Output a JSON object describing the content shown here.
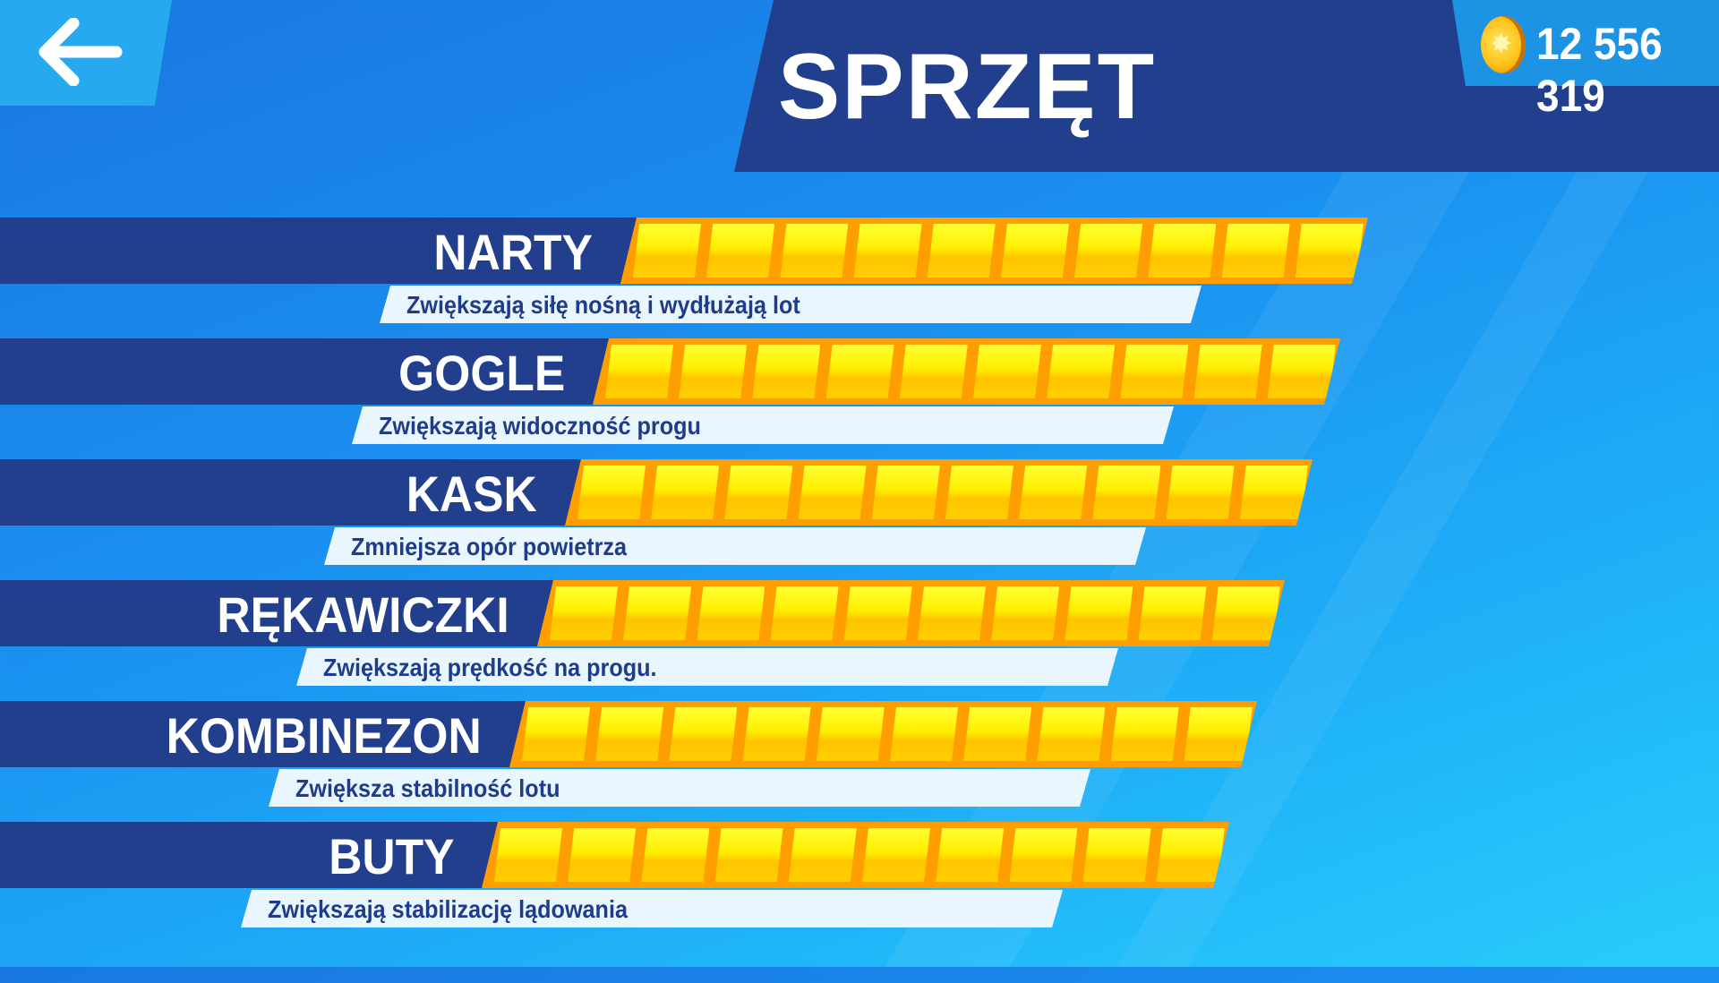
{
  "header": {
    "title": "SPRZĘT",
    "back_icon": "arrow-left-icon"
  },
  "wallet": {
    "coin_icon": "coin-icon",
    "amount": "12 556 319"
  },
  "equipment": [
    {
      "name": "NARTY",
      "description": "Zwiększają siłę nośną i wydłużają lot",
      "level": 10,
      "max_level": 10
    },
    {
      "name": "GOGLE",
      "description": "Zwiększają widoczność progu",
      "level": 10,
      "max_level": 10
    },
    {
      "name": "KASK",
      "description": "Zmniejsza opór powietrza",
      "level": 10,
      "max_level": 10
    },
    {
      "name": "RĘKAWICZKI",
      "description": "Zwiększają prędkość na progu.",
      "level": 10,
      "max_level": 10
    },
    {
      "name": "KOMBINEZON",
      "description": "Zwiększa stabilność lotu",
      "level": 10,
      "max_level": 10
    },
    {
      "name": "BUTY",
      "description": "Zwiększają stabilizację lądowania",
      "level": 10,
      "max_level": 10
    }
  ],
  "colors": {
    "background": "#1a8ff0",
    "banner": "#213f8c",
    "bar_fill": "#ffee00",
    "bar_border": "#ff9e00",
    "description_bg": "#e9f6fd",
    "description_text": "#1f3c8a"
  }
}
